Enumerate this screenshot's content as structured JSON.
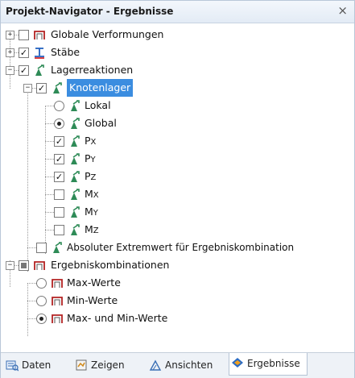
{
  "window": {
    "title": "Projekt-Navigator - Ergebnisse",
    "close_glyph": "×"
  },
  "tree": {
    "globale_verformungen": {
      "label": "Globale Verformungen",
      "checked": false,
      "expanded": false
    },
    "staebe": {
      "label": "Stäbe",
      "checked": true,
      "expanded": false
    },
    "lagerreaktionen": {
      "label": "Lagerreaktionen",
      "checked": true,
      "expanded": true
    },
    "knotenlager": {
      "label": "Knotenlager",
      "checked": true,
      "expanded": true,
      "selected": true
    },
    "lokal": {
      "label": "Lokal",
      "selected": false
    },
    "global": {
      "label": "Global",
      "selected": true
    },
    "px": {
      "label_main": "P",
      "label_sub": "X",
      "checked": true
    },
    "py": {
      "label_main": "P",
      "label_sub": "Y",
      "checked": true
    },
    "pz": {
      "label_main": "P",
      "label_sub": "Z",
      "checked": true
    },
    "mx": {
      "label_main": "M",
      "label_sub": "X",
      "checked": false
    },
    "my": {
      "label_main": "M",
      "label_sub": "Y",
      "checked": false
    },
    "mz": {
      "label_main": "M",
      "label_sub": "Z",
      "checked": false
    },
    "absolut": {
      "label": "Absoluter Extremwert für Ergebniskombination",
      "checked": false
    },
    "ergebniskombinationen": {
      "label": "Ergebniskombinationen",
      "state": "partial",
      "expanded": true
    },
    "max": {
      "label": "Max-Werte",
      "selected": false
    },
    "min": {
      "label": "Min-Werte",
      "selected": false
    },
    "maxmin": {
      "label": "Max- und Min-Werte",
      "selected": true
    }
  },
  "tabs": [
    {
      "label": "Daten",
      "icon": "data-icon",
      "active": false
    },
    {
      "label": "Zeigen",
      "icon": "show-icon",
      "active": false
    },
    {
      "label": "Ansichten",
      "icon": "views-icon",
      "active": false
    },
    {
      "label": "Ergebnisse",
      "icon": "results-icon",
      "active": true
    }
  ],
  "colors": {
    "selection": "#3b8de0",
    "support_icon_green": "#2e8b57",
    "frame_icon_red": "#b22222"
  }
}
